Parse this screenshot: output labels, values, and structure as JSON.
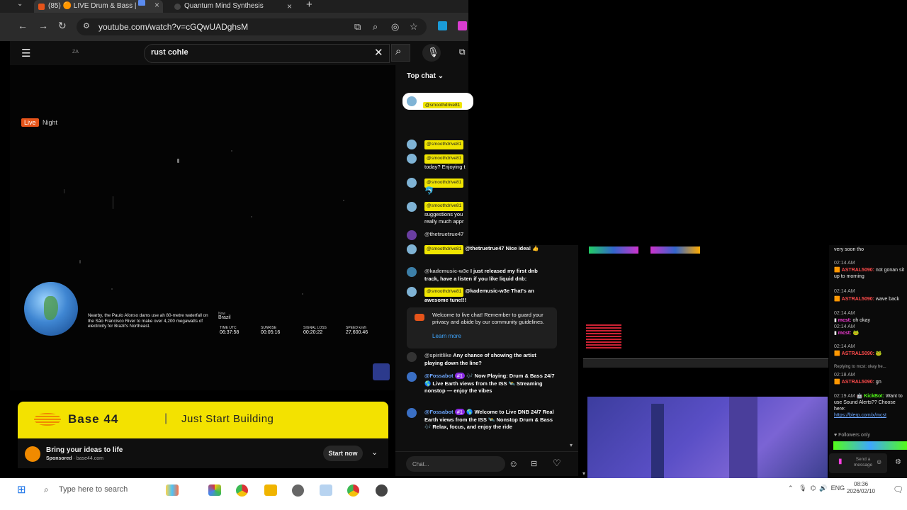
{
  "browser": {
    "tabs": [
      {
        "label": "(85) 🟠 LIVE Drum & Bass |",
        "active": true
      },
      {
        "label": "Quantum Mind Synthesis",
        "active": false
      }
    ],
    "url": "youtube.com/watch?v=cGQwUADghsM"
  },
  "youtube": {
    "masthead_logo": "ZA",
    "search_query": "rust cohle",
    "video": {
      "live_label": "Live",
      "night_label": "Night",
      "caption": "Nearby, the Paulo Afonso dams use an 80-metre waterfall on the São Francisco River to make over 4,200 megawatts of electricity for Brazil's Northeast.",
      "location_label": "Now",
      "location": "Brazil",
      "stats": [
        {
          "label": "TIME UTC",
          "value": "06:37:58"
        },
        {
          "label": "SUNRISE",
          "value": "00:05:16"
        },
        {
          "label": "SIGNAL LOSS",
          "value": "00:20:22"
        },
        {
          "label": "SPEED km/h",
          "value": "27,600.46"
        }
      ]
    },
    "ad": {
      "brand": "Base 44",
      "separator": "|",
      "tagline": "Just Start Building",
      "title": "Bring your ideas to life",
      "sponsored": "Sponsored",
      "domain": "base44.com",
      "cta": "Start now"
    },
    "chat": {
      "header": "Top chat",
      "pinned_user": "@smoothdrive81",
      "messages": [
        {
          "user": "@smoothdrive81",
          "text": ""
        },
        {
          "user": "@smoothdrive81",
          "text": "today? Enjoying t"
        },
        {
          "user": "@smoothdrive81",
          "text": ""
        },
        {
          "user": "@smoothdrive81",
          "text": "suggestions you really much appr"
        },
        {
          "user": "@thetruetrue47",
          "text": ""
        },
        {
          "user": "@smoothdrive81",
          "text": "@thetruetrue47 Nice idea! 👍"
        },
        {
          "user": "@kademusic-w3e",
          "text": "I just released my first dnb track, have a listen if you like liquid dnb:"
        },
        {
          "user": "@smoothdrive81",
          "text": "@kademusic-w3e That's an awesome tune!!!"
        }
      ],
      "welcome": "Welcome to live chat! Remember to guard your privacy and abide by our community guidelines.",
      "learn_more": "Learn more",
      "messages2": [
        {
          "user": "@spiritlike",
          "text": "Any chance of showing the artist playing down the line?"
        },
        {
          "user": "@Fossabot",
          "badge": "#1",
          "text": "🎶 Now Playing: Drum & Bass 24/7 🌎 Live Earth views from the ISS 🛰️ Streaming nonstop — enjoy the vibes"
        },
        {
          "user": "@Fossabot",
          "badge": "#1",
          "text": "🌎 Welcome to Live DNB 24/7 Real Earth views from the ISS 🛰️ Nonstop Drum & Bass 🎶 Relax, focus, and enjoy the ride"
        }
      ],
      "input_placeholder": "Chat..."
    }
  },
  "kick_chat": {
    "lines": [
      {
        "type": "text",
        "text": "very soon tho"
      },
      {
        "type": "time",
        "text": "02:14 AM"
      },
      {
        "type": "msg",
        "user": "ASTRAL5090:",
        "text": "not gonan sit up to morning"
      },
      {
        "type": "time",
        "text": "02:14 AM"
      },
      {
        "type": "msg",
        "user": "ASTRAL5090:",
        "text": "wave back"
      },
      {
        "type": "time",
        "text": "02:14 AM"
      },
      {
        "type": "msg",
        "user": "mcst:",
        "text": "oh okay"
      },
      {
        "type": "time",
        "text": "02:14 AM"
      },
      {
        "type": "msg",
        "user": "mcst:",
        "text": ""
      },
      {
        "type": "time",
        "text": "02:14 AM"
      },
      {
        "type": "msg",
        "user": "ASTRAL5090:",
        "text": ""
      },
      {
        "type": "reply",
        "text": "Replying to mcst: okay he..."
      },
      {
        "type": "time",
        "text": "02:18 AM"
      },
      {
        "type": "msg",
        "user": "ASTRAL5090:",
        "text": "gn"
      },
      {
        "type": "bot",
        "time": "02:19 AM",
        "user": "KickBot:",
        "text": "Want to use Sound Alerts?? Choose here:",
        "link": "https://blerp.com/x/mcst"
      },
      {
        "type": "text",
        "text": "Followers only"
      }
    ],
    "send_placeholder": "Send a message"
  },
  "taskbar": {
    "search_placeholder": "Type here to search",
    "language": "ENG",
    "time": "08:36",
    "date": "2026/02/10"
  },
  "colors": {
    "ad_yellow": "#f3e200",
    "live_orange": "#e6541a",
    "kick_green": "#53fc18",
    "link_blue": "#3ea6ff"
  }
}
